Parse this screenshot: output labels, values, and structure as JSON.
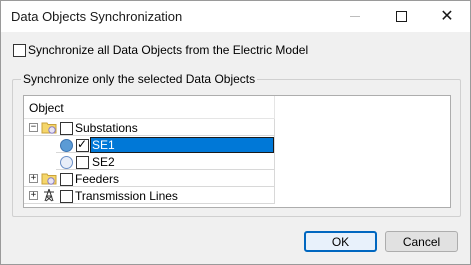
{
  "window": {
    "title": "Data Objects Synchronization",
    "close_glyph": "✕"
  },
  "sync_all": {
    "label": "Synchronize all Data Objects from the Electric Model",
    "checked": false
  },
  "group": {
    "legend": "Synchronize only the selected Data Objects"
  },
  "tree": {
    "column_header": "Object",
    "nodes": [
      {
        "label": "Substations",
        "expander": "−",
        "checked": false,
        "icon": "folder-substation-icon"
      },
      {
        "label": "SE1",
        "checked": true,
        "selected": true,
        "icon": "circle-blue-icon"
      },
      {
        "label": "SE2",
        "checked": false,
        "icon": "circle-light-icon"
      },
      {
        "label": "Feeders",
        "expander": "+",
        "checked": false,
        "icon": "folder-feeder-icon"
      },
      {
        "label": "Transmission Lines",
        "expander": "+",
        "checked": false,
        "icon": "transmission-tower-icon"
      }
    ],
    "checkmark": "✓"
  },
  "buttons": {
    "ok": "OK",
    "cancel": "Cancel"
  }
}
